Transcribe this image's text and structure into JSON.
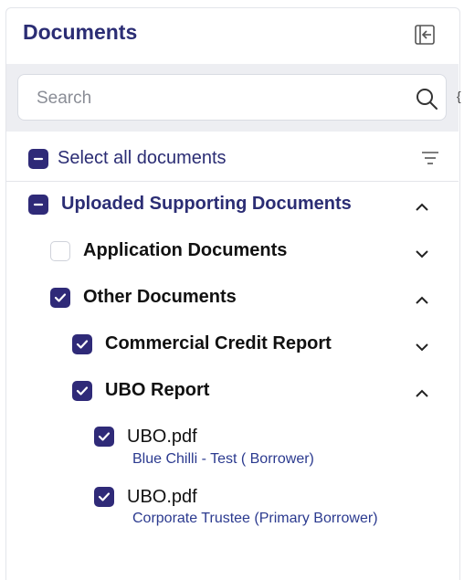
{
  "panel": {
    "title": "Documents"
  },
  "search": {
    "placeholder": "Search",
    "value": ""
  },
  "select_all": {
    "label": "Select all documents"
  },
  "tree": {
    "root": {
      "label": "Uploaded Supporting Documents",
      "state": "partial",
      "expanded": true
    },
    "application_documents": {
      "label": "Application Documents",
      "checked": false,
      "expanded": false
    },
    "other_documents": {
      "label": "Other Documents",
      "checked": true,
      "expanded": true
    },
    "commercial_credit_report": {
      "label": "Commercial Credit Report",
      "checked": true,
      "expanded": false
    },
    "ubo_report": {
      "label": "UBO Report",
      "checked": true,
      "expanded": true
    },
    "files": [
      {
        "name": "UBO.pdf",
        "owner": "Blue Chilli - Test ( Borrower)",
        "checked": true
      },
      {
        "name": "UBO.pdf",
        "owner": "Corporate Trustee (Primary Borrower)",
        "checked": true
      }
    ]
  },
  "colors": {
    "accent": "#2b2d74",
    "checkbox_fill": "#2f2a78",
    "search_band": "#edeef2",
    "link": "#2b3a8f"
  },
  "icons": [
    "collapse-panel-icon",
    "search-icon",
    "filter-icon",
    "chevron-up-icon",
    "chevron-down-icon",
    "check-icon",
    "minus-icon"
  ]
}
